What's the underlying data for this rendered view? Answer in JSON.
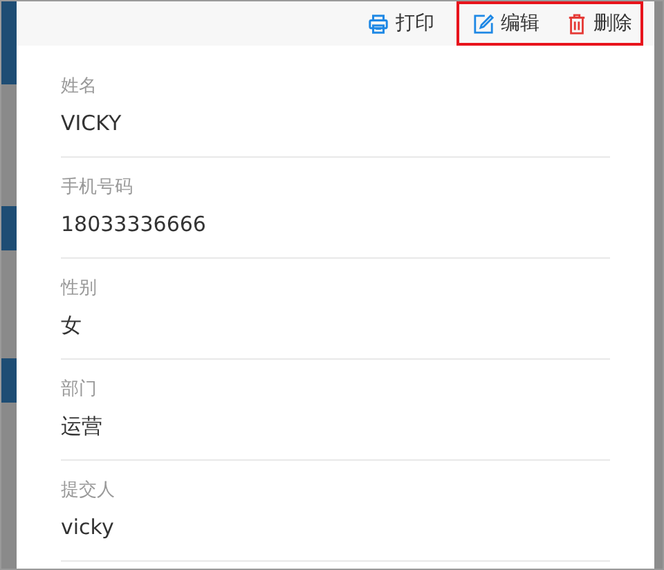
{
  "toolbar": {
    "actions": [
      {
        "kind": "print",
        "label": "打印",
        "highlighted": false
      },
      {
        "kind": "edit",
        "label": "编辑",
        "highlighted": true
      },
      {
        "kind": "delete",
        "label": "删除",
        "highlighted": true
      }
    ]
  },
  "fields": [
    {
      "label": "姓名",
      "value": "VICKY"
    },
    {
      "label": "手机号码",
      "value": "18033336666"
    },
    {
      "label": "性别",
      "value": "女"
    },
    {
      "label": "部门",
      "value": "运营"
    },
    {
      "label": "提交人",
      "value": "vicky"
    }
  ]
}
